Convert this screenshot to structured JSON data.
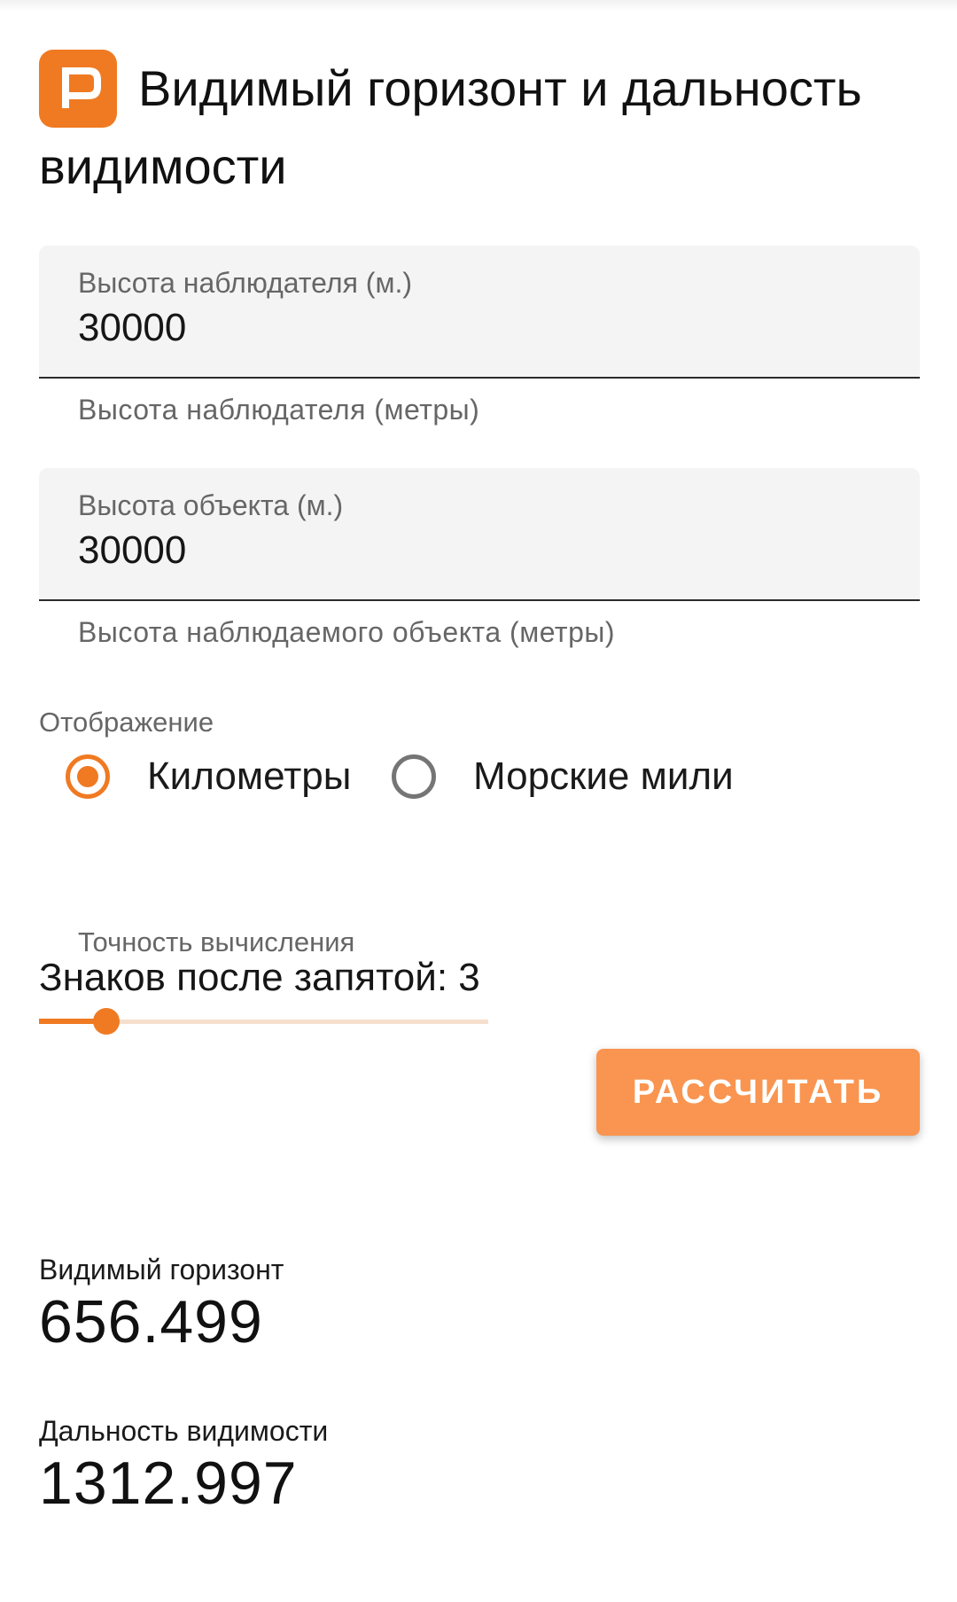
{
  "header": {
    "app_icon": "orange-p-logo-icon",
    "title": "Видимый горизонт и дальность видимости"
  },
  "fields": [
    {
      "label": "Высота наблюдателя (м.)",
      "value": "30000",
      "helper": "Высота наблюдателя (метры)"
    },
    {
      "label": "Высота объекта (м.)",
      "value": "30000",
      "helper": "Высота наблюдаемого объекта (метры)"
    }
  ],
  "display": {
    "label": "Отображение",
    "options": [
      {
        "label": "Километры",
        "selected": true
      },
      {
        "label": "Морские мили",
        "selected": false
      }
    ]
  },
  "precision": {
    "caption": "Точность вычисления",
    "value_text": "Знаков после запятой: 3",
    "slider_fraction": 0.15
  },
  "calculate_button": "РАССЧИТАТЬ",
  "results": [
    {
      "label": "Видимый горизонт",
      "value": "656.499"
    },
    {
      "label": "Дальность видимости",
      "value": "1312.997"
    }
  ],
  "colors": {
    "accent": "#f07a22",
    "button": "#f99550",
    "slider_track": "#f6dfcd"
  }
}
